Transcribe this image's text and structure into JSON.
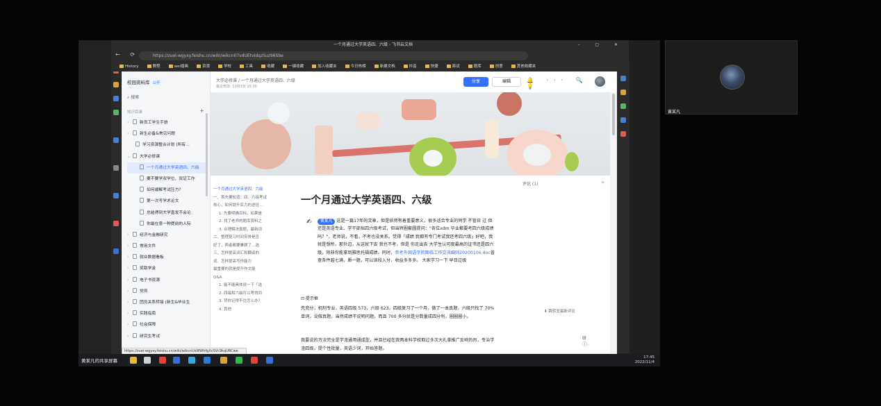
{
  "browser": {
    "tab_title": "一个月通过大学英语四、六级 - 飞书云文档",
    "window_controls": "– ▢ ✕",
    "url": "https://zuel-wgyxy.feishu.cn/wiki/wikcn07vdUEtvIdqzSuz96Sbe",
    "nav": "← ⟳",
    "bookmarks": [
      "History",
      "教程",
      "wei插画",
      "资源",
      "学校",
      "工具",
      "收藏",
      "一键收藏",
      "加入收藏夹",
      "今日热榜",
      "新建文档",
      "抖音",
      "快捷",
      "面试",
      "题库",
      "创意",
      "其他收藏夹"
    ]
  },
  "sidebar": {
    "kb_name": "校园资料库",
    "kb_badge": "公开",
    "search": "搜索",
    "directory_label": "知识目录",
    "plus": "+",
    "items": [
      {
        "label": "新员工学生手册",
        "arrow": "›"
      },
      {
        "label": "新生必备&常见问题",
        "arrow": "›"
      },
      {
        "label": "学习资源整合计划 (所有…",
        "arrow": ""
      },
      {
        "label": "大学必修课",
        "arrow": "⌄"
      },
      {
        "label": "一个月通过大学英语四、六级",
        "arrow": "",
        "selected": true
      },
      {
        "label": "要不要学双学位、双证工作",
        "arrow": ""
      },
      {
        "label": "如何缓解考试压力?",
        "arrow": ""
      },
      {
        "label": "第一次写学术论文",
        "arrow": ""
      },
      {
        "label": "总结得到大学直发不会论",
        "arrow": ""
      },
      {
        "label": "你最在意一种提前的人际",
        "arrow": ""
      },
      {
        "label": "经济与金融研究",
        "arrow": "›"
      },
      {
        "label": "常用文件",
        "arrow": "›"
      },
      {
        "label": "就业数据看板",
        "arrow": "›"
      },
      {
        "label": "奖助学金",
        "arrow": "›"
      },
      {
        "label": "电子书资源",
        "arrow": "›"
      },
      {
        "label": "党员",
        "arrow": "›"
      },
      {
        "label": "团员关系转接 (新生&毕业生",
        "arrow": "›"
      },
      {
        "label": "实践指南",
        "arrow": "›"
      },
      {
        "label": "社会保障",
        "arrow": "›"
      },
      {
        "label": "研究生考试",
        "arrow": "›"
      }
    ],
    "status_url": "https://zuel-wgyxy.feishu.cn/wiki/wikcnUsWWhfgXcSVc9kqURCwe"
  },
  "doc_header": {
    "breadcrumb": "大学必修课  /  一个月通过大学英语四、六级",
    "meta": "最近修改: 10月3日 15:30",
    "share": "分享",
    "edit": "编辑",
    "icons": "🔔 ··· 🔍 + 💡"
  },
  "outline": [
    {
      "text": "一个月通过大学英语四、六级",
      "head": true
    },
    {
      "text": "一、首先要知道：四、六级考试",
      "head": false
    },
    {
      "text": "核心，如何提升实力的途径…",
      "head": false
    },
    {
      "text": "1. 先要明确目标，如果是",
      "head": false
    },
    {
      "text": "2. 找了老师的题库资料之",
      "head": false
    },
    {
      "text": "3. 合理解决真题，最新词",
      "head": false
    },
    {
      "text": "二、整理复习时间安排是否",
      "head": false
    },
    {
      "text": "好了，两者都要兼顾了…选",
      "head": false
    },
    {
      "text": "三、怎样提高词汇和翻译的",
      "head": false
    },
    {
      "text": "词、怎样提高写作能力",
      "head": false
    },
    {
      "text": "最重要的就是提升作文能",
      "head": false
    },
    {
      "text": "Q&A",
      "head": false
    },
    {
      "text": "1. 能不能具体说一下「选",
      "head": false
    },
    {
      "text": "2. 四级和六级可以考得同",
      "head": false
    },
    {
      "text": "3. 背你记得不住怎么办？",
      "head": false
    },
    {
      "text": "4. 其他",
      "head": false
    }
  ],
  "content": {
    "comment_count": "评论 (1)",
    "collapse": "»",
    "title": "一个月通过大学英语四、六级",
    "callout_hand": "✍",
    "mention": "黄某凡",
    "callout_text": "这是一篇17年的文章，但是依然有着重要意义，很多适合专业的同学 不管日 过 但 还是英语专业、学干部拟四六级考试，但当转圈套圆提问：\"各位xdm 毕业都要考四六级成绩吗？\"，老师说，不看，不考也没关系。觉得「成绩 我都有专门考试我还考四六级」好吧，我就是想所，那外边，从这就下去 我也不考，但是 你走出去 大学生认可度最高的证书还是四六级，除非你能拿到雅思托福成绩。同时，",
    "callout_link": "参考外国语学院面临工作交流细则20200106.doc",
    "callout_tail": "普查条件越七满，质一题，可以读段入分，收益多多多。 大家学习一下 早日过级",
    "tip": "⊡ 提示框",
    "p1": "先充分，机制专业，英语四级 573，六级 623，四级复习了一个月，做了一本真题，六级只找了 70% 单词，没做真题，当然成绩不说明问题，而且 700 多分就是分数量成四分利，圈圈圈小。",
    "p2": "我要说的方法完全是学渣通用通成型，并且已经在我两本科学校取过多次大礼拿推广反响热烈，专治学渣四级，提个性批量，英语少词，开始答题。",
    "jump": "⬇  跳转至最新评论",
    "float_icons": "⊞ ⓘ"
  },
  "taskbar": {
    "presenter": "黄某凡的共享屏幕",
    "time": "17:45",
    "date": "2022/11/4"
  },
  "participant": {
    "name": "黄某凡"
  }
}
